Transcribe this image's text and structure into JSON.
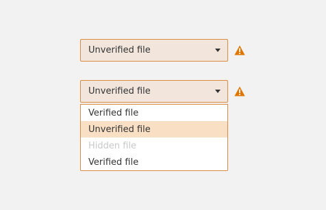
{
  "select1": {
    "value": "Unverified file",
    "caret_icon": "caret-down-icon",
    "warning_icon": "warning-triangle-icon"
  },
  "select2": {
    "value": "Unverified file",
    "caret_icon": "caret-down-icon",
    "warning_icon": "warning-triangle-icon",
    "options": [
      {
        "label": "Verified file",
        "state": "normal"
      },
      {
        "label": "Unverified file",
        "state": "highlighted"
      },
      {
        "label": "Hidden file",
        "state": "disabled"
      },
      {
        "label": "Verified file",
        "state": "normal"
      }
    ]
  },
  "colors": {
    "background": "#f2f2f2",
    "select_fill": "#f1e5dc",
    "border_accent": "#d98a3c",
    "warning": "#e07500",
    "highlight": "#f9dfc4",
    "disabled_text": "#c8c8c8"
  }
}
